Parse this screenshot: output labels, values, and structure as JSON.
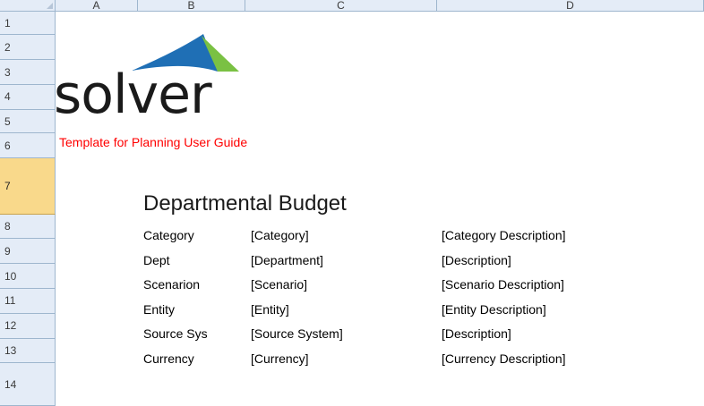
{
  "columns": [
    "A",
    "B",
    "C",
    "D"
  ],
  "rows": [
    "1",
    "2",
    "3",
    "4",
    "5",
    "6",
    "7",
    "8",
    "9",
    "10",
    "11",
    "12",
    "13",
    "14"
  ],
  "active_row": "7",
  "logo": {
    "text": "solver",
    "colors": {
      "blue": "#1f6fb5",
      "green": "#7ac143",
      "dark": "#1a1a1a"
    }
  },
  "subtitle": "Template for Planning User Guide",
  "title": "Departmental Budget",
  "fields": [
    {
      "label": "Category",
      "value": "[Category]",
      "desc": "[Category Description]"
    },
    {
      "label": "Dept",
      "value": "[Department]",
      "desc": "[Description]"
    },
    {
      "label": "Scenarion",
      "value": "[Scenario]",
      "desc": "[Scenario Description]"
    },
    {
      "label": "Entity",
      "value": "[Entity]",
      "desc": "[Entity Description]"
    },
    {
      "label": "Source Sys",
      "value": "[Source System]",
      "desc": "[Description]"
    },
    {
      "label": "Currency",
      "value": "[Currency]",
      "desc": "[Currency Description]"
    }
  ],
  "colors": {
    "header_bg": "#e4ecf7",
    "header_border": "#9eb6ce",
    "active_row_bg": "#f9d98b",
    "subtitle": "#ff0000"
  }
}
